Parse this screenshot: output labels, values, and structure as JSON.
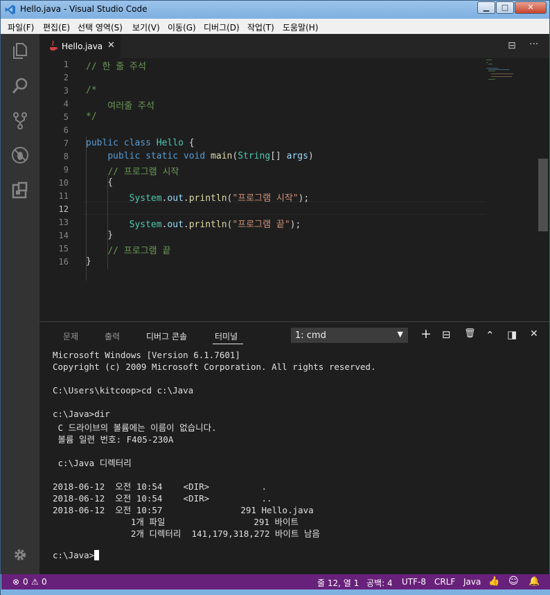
{
  "window": {
    "title": "Hello.java - Visual Studio Code",
    "controls": {
      "minimize": "▁",
      "maximize": "□",
      "close": "✕"
    }
  },
  "menu": [
    "파일(F)",
    "편집(E)",
    "선택 영역(S)",
    "보기(V)",
    "이동(G)",
    "디버그(D)",
    "작업(T)",
    "도움말(H)"
  ],
  "activity_bar": [
    "explorer-icon",
    "search-icon",
    "source-control-icon",
    "debug-icon",
    "extensions-icon",
    "settings-gear-icon"
  ],
  "tabs": [
    {
      "label": "Hello.java",
      "close": "✕"
    }
  ],
  "tab_actions": {
    "split": "⊟",
    "more": "···"
  },
  "editor": {
    "current_line": 12,
    "lines": [
      "1",
      "2",
      "3",
      "4",
      "5",
      "6",
      "7",
      "8",
      "9",
      "10",
      "11",
      "12",
      "13",
      "14",
      "15",
      "16"
    ]
  },
  "panel": {
    "tabs": [
      "문제",
      "출력",
      "디버그 콘솔",
      "터미널"
    ],
    "active_tab": "터미널",
    "terminal_select": "1: cmd",
    "actions": {
      "add": "+",
      "split": "⊟",
      "kill": "🗑",
      "maximize": "⌃",
      "toggle": "◨",
      "close": "✕"
    },
    "terminal_lines": [
      "Microsoft Windows [Version 6.1.7601]",
      "Copyright (c) 2009 Microsoft Corporation. All rights reserved.",
      "",
      "C:\\Users\\kitcoop>cd c:\\Java",
      "",
      "c:\\Java>dir",
      " C 드라이브의 볼륨에는 이름이 없습니다.",
      " 볼륨 일련 번호: F405-230A",
      "",
      " c:\\Java 디렉터리",
      "",
      "2018-06-12  오전 10:54    <DIR>          .",
      "2018-06-12  오전 10:54    <DIR>          ..",
      "2018-06-12  오전 10:57               291 Hello.java",
      "               1개 파일                 291 바이트",
      "               2개 디렉터리  141,179,318,272 바이트 남음",
      "",
      "c:\\Java>"
    ]
  },
  "status": {
    "errors": "0",
    "warnings": "0",
    "position": "줄 12, 열 1",
    "spaces": "공백: 4",
    "encoding": "UTF-8",
    "eol": "CRLF",
    "language": "Java"
  },
  "colors": {
    "status_bar": "#68217a",
    "activity_bar": "#333333",
    "editor_bg": "#1e1e1e"
  }
}
